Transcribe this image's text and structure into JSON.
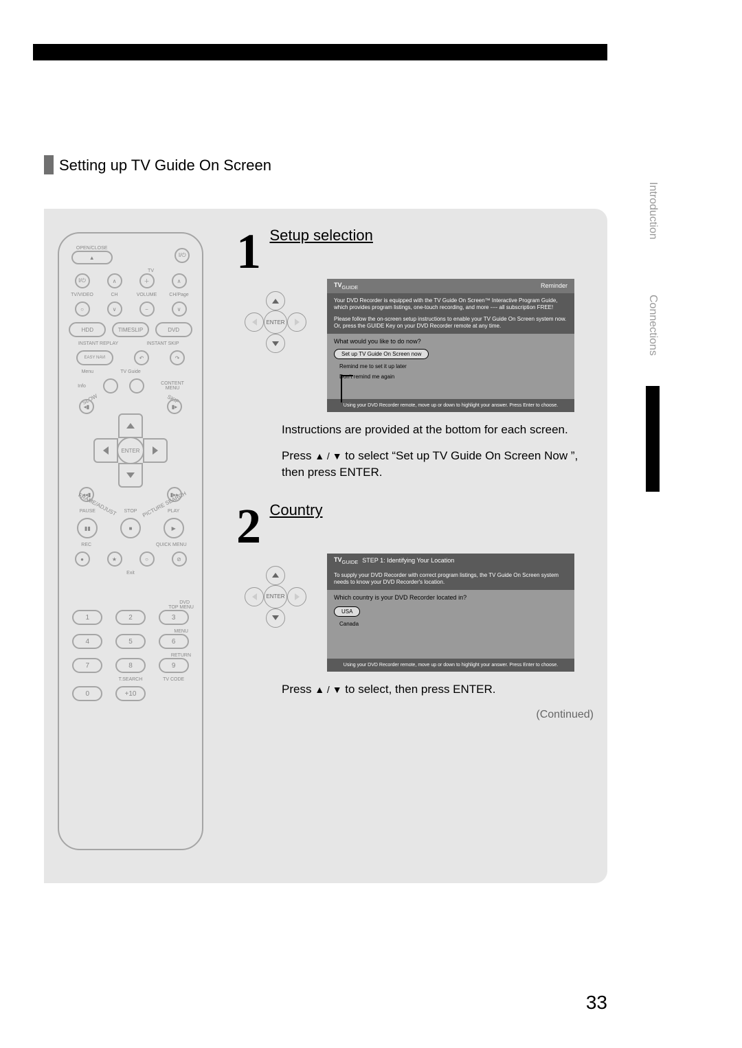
{
  "page_title": "Setting up TV Guide On Screen",
  "page_number": "33",
  "tabs": {
    "introduction": "Introduction",
    "connections": "Connections"
  },
  "remote": {
    "open_close": "OPEN/CLOSE",
    "tv": "TV",
    "power": "I/⏻",
    "tv_video": "TV/VIDEO",
    "ch": "CH",
    "volume": "VOLUME",
    "ch_page": "CH/Page",
    "hdd": "HDD",
    "timeslip": "TIMESLIP",
    "dvd": "DVD",
    "instant_replay": "INSTANT REPLAY",
    "instant_skip": "INSTANT SKIP",
    "easy_navi": "EASY NAVI",
    "menu": "Menu",
    "tv_guide": "TV Guide",
    "info": "Info",
    "content_menu": "CONTENT MENU",
    "slow": "SLOW",
    "skip": "SKIP",
    "enter": "ENTER",
    "frame_adjust": "FRAME/ADJUST",
    "picture_search": "PICTURE SEARCH",
    "pause": "PAUSE",
    "stop": "STOP",
    "play": "PLAY",
    "rec": "REC",
    "quick_menu": "QUICK MENU",
    "exit": "Exit",
    "dvd_top": "DVD",
    "top_menu": "TOP MENU",
    "menu2": "MENU",
    "return": "RETURN",
    "t_search": "T.SEARCH",
    "tv_code": "TV CODE",
    "nums": [
      "1",
      "2",
      "3",
      "4",
      "5",
      "6",
      "7",
      "8",
      "9",
      "0",
      "+10"
    ]
  },
  "step1": {
    "number": "1",
    "title": "Setup selection",
    "enter": "ENTER",
    "screen": {
      "logo": "TV",
      "logo_sub": "GUIDE",
      "reminder": "Reminder",
      "intro1": "Your DVD Recorder is equipped with the TV Guide On Screen™ Interactive Program Guide, which provides program listings, one-touch recording, and more ---- all subscription FREE!",
      "intro2": "Please follow the on-screen setup instructions to enable your TV Guide On Screen system now. Or, press the GUIDE Key on your DVD Recorder remote at any time.",
      "prompt": "What would you like to do now?",
      "opt1": "Set up TV Guide On Screen now",
      "opt2": "Remind me to set it up later",
      "opt3": "Don't remind me again",
      "footer": "Using your DVD Recorder remote, move up or down to highlight your answer. Press Enter to choose."
    },
    "note": "Instructions are provided at the bottom for each screen.",
    "instruction_pre": "Press ",
    "instruction_mid": " to select  “Set up TV Guide On Screen Now ”, then press ENTER."
  },
  "step2": {
    "number": "2",
    "title": "Country",
    "enter": "ENTER",
    "screen": {
      "logo": "TV",
      "logo_sub": "GUIDE",
      "step_header": "STEP 1: Identifying Your Location",
      "intro": "To supply your DVD Recorder with correct program listings, the TV Guide On Screen system needs to know your DVD Recorder's location.",
      "prompt": "Which country is your DVD Recorder located in?",
      "opt1": "USA",
      "opt2": "Canada",
      "footer": "Using your DVD Recorder remote, move up or down to highlight your answer. Press Enter to choose."
    },
    "instruction_pre": "Press ",
    "instruction_post": " to select, then press ENTER."
  },
  "continued": "(Continued)"
}
